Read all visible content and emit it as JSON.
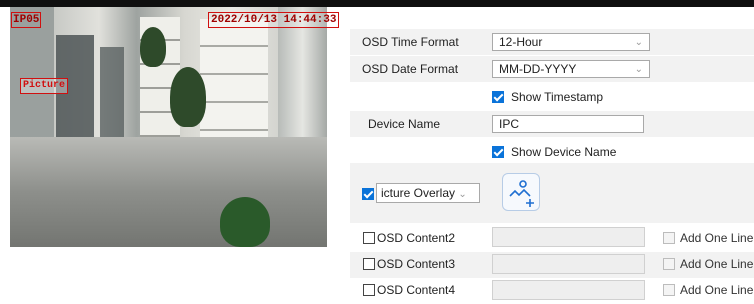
{
  "preview": {
    "osd_device_name": "IP05",
    "osd_timestamp": "2022/10/13 14:44:33",
    "osd_picture_label": "Picture"
  },
  "settings": {
    "time_format_label": "OSD Time Format",
    "time_format_value": "12-Hour",
    "date_format_label": "OSD Date Format",
    "date_format_value": "MM-DD-YYYY",
    "show_timestamp_label": "Show Timestamp",
    "show_timestamp_checked": true,
    "device_name_label": "Device Name",
    "device_name_value": "IPC",
    "show_device_name_label": "Show Device Name",
    "show_device_name_checked": true,
    "overlay_select_value": "icture Overlay",
    "overlay_checked": true,
    "content_rows": [
      {
        "label": "OSD Content2",
        "add_label": "Add One Line"
      },
      {
        "label": "OSD Content3",
        "add_label": "Add One Line"
      },
      {
        "label": "OSD Content4",
        "add_label": "Add One Line"
      }
    ]
  },
  "icons": {
    "dropdown": "chevron-down-icon",
    "upload": "add-image-icon"
  },
  "colors": {
    "accent": "#0a73d9",
    "osd_red": "#d01010",
    "row_shade": "#f2f2f2"
  }
}
